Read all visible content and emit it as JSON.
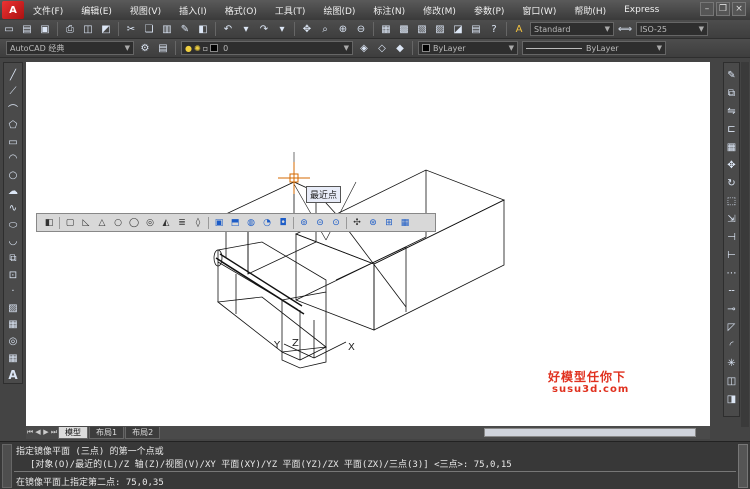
{
  "menu": {
    "logo": "A",
    "items": [
      "文件(F)",
      "编辑(E)",
      "视图(V)",
      "插入(I)",
      "格式(O)",
      "工具(T)",
      "绘图(D)",
      "标注(N)",
      "修改(M)",
      "参数(P)",
      "窗口(W)",
      "帮助(H)",
      "Express"
    ]
  },
  "toolbar1": {
    "text_style": "Standard",
    "dim_style": "ISO-25"
  },
  "toolbar2": {
    "workspace": "AutoCAD 经典",
    "layer": "0",
    "color": "ByLayer",
    "linetype": "ByLayer"
  },
  "canvas": {
    "tooltip": "最近点",
    "axis_x": "X",
    "axis_y": "Y",
    "axis_z": "Z",
    "watermark_line1": "好模型任你下",
    "watermark_line2": "susu3d.com"
  },
  "tabs": [
    "模型",
    "布局1",
    "布局2"
  ],
  "command": {
    "line1": "指定镜像平面 (三点) 的第一个点或",
    "line2": "[对象(O)/最近的(L)/Z 轴(Z)/视图(V)/XY 平面(XY)/YZ 平面(YZ)/ZX 平面(ZX)/三点(3)] <三点>: 75,0,15",
    "line3": "在镜像平面上指定第二点: 75,0,35"
  }
}
